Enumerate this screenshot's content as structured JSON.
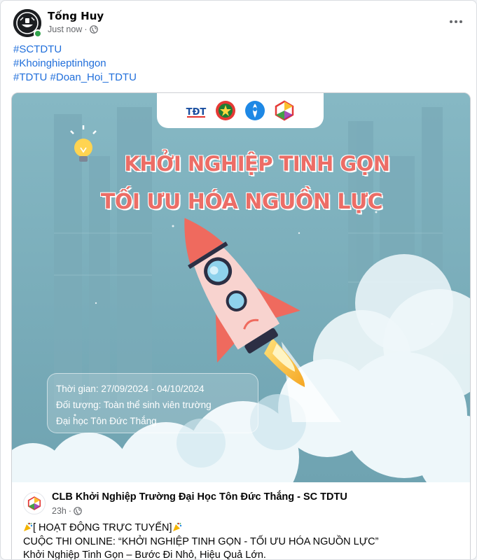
{
  "post": {
    "author": "Tống Huy",
    "time": "Just now",
    "hashtags": [
      [
        "#SCTDTU"
      ],
      [
        "#Khoinghieptinhgon"
      ],
      [
        "#TDTU",
        "#Doan_Hoi_TDTU"
      ]
    ]
  },
  "shared_post": {
    "headline_line1": "KHỞI NGHIỆP TINH GỌN",
    "headline_line2": "TỐI ƯU HÓA NGUỒN LỰC",
    "info_lines": [
      "Thời gian: 27/09/2024 - 04/10/2024",
      "Đối tượng: Toàn thể sinh viên trường",
      "Đại học Tôn Đức Thắng"
    ],
    "logo_text": "TĐT",
    "page_name": "CLB Khởi Nghiệp Trường Đại Học Tôn Đức Thắng - SC TDTU",
    "page_time": "23h",
    "text_lines": [
      "[ HOẠT ĐỘNG TRỰC TUYẾN]",
      "CUỘC THI ONLINE:  “KHỞI NGHIỆP TINH GỌN - TỐI ƯU HÓA NGUỒN LỰC”",
      "Khởi Nghiệp Tinh Gọn – Bước Đi Nhỏ, Hiệu Quả Lớn."
    ]
  },
  "icons": {
    "more": "more-horizontal-icon",
    "audience": "globe-icon",
    "celebrate": "party-popper-icon",
    "idea": "lightbulb-icon"
  },
  "colors": {
    "hashtag": "#216fdb",
    "headline": "#ec6d66",
    "poster_bg": "#7eb0bd",
    "online": "#31a24c"
  }
}
